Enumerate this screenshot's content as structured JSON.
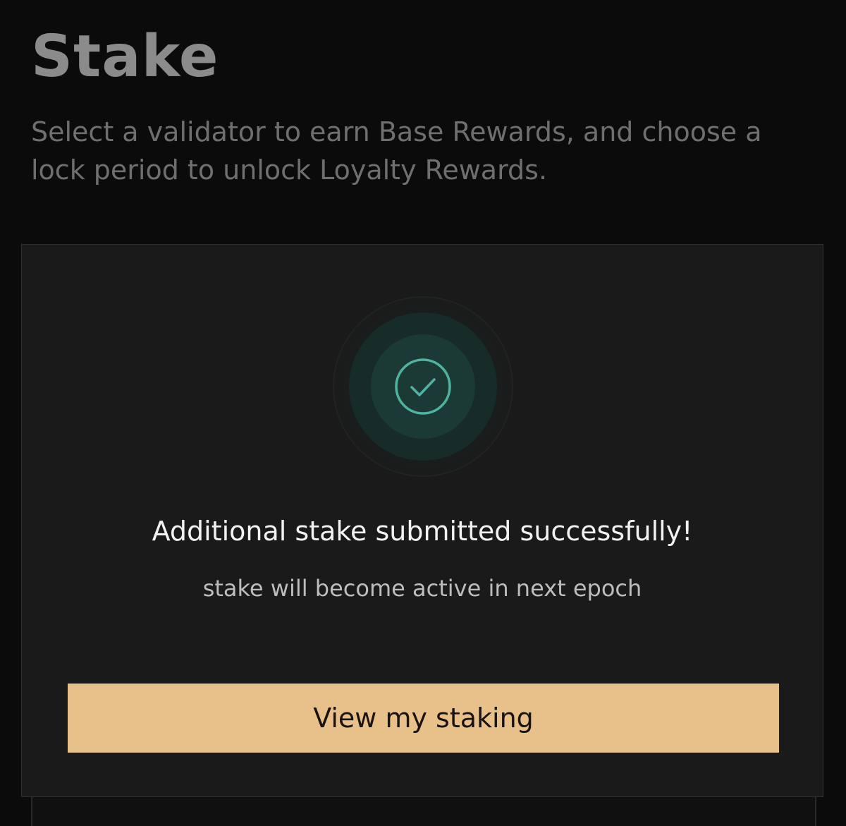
{
  "header": {
    "title": "Stake",
    "subtitle": "Select a validator to earn Base Rewards, and choose a lock period to unlock Loyalty Rewards."
  },
  "modal": {
    "icon": "check-circle-icon",
    "title": "Additional stake submitted successfully!",
    "message": "stake will become active in next epoch",
    "button_label": "View my staking"
  },
  "colors": {
    "accent": "#e8c08a",
    "success": "#4fb3a2",
    "background": "#0b0b0c",
    "modal_background": "#1a1a1b"
  }
}
